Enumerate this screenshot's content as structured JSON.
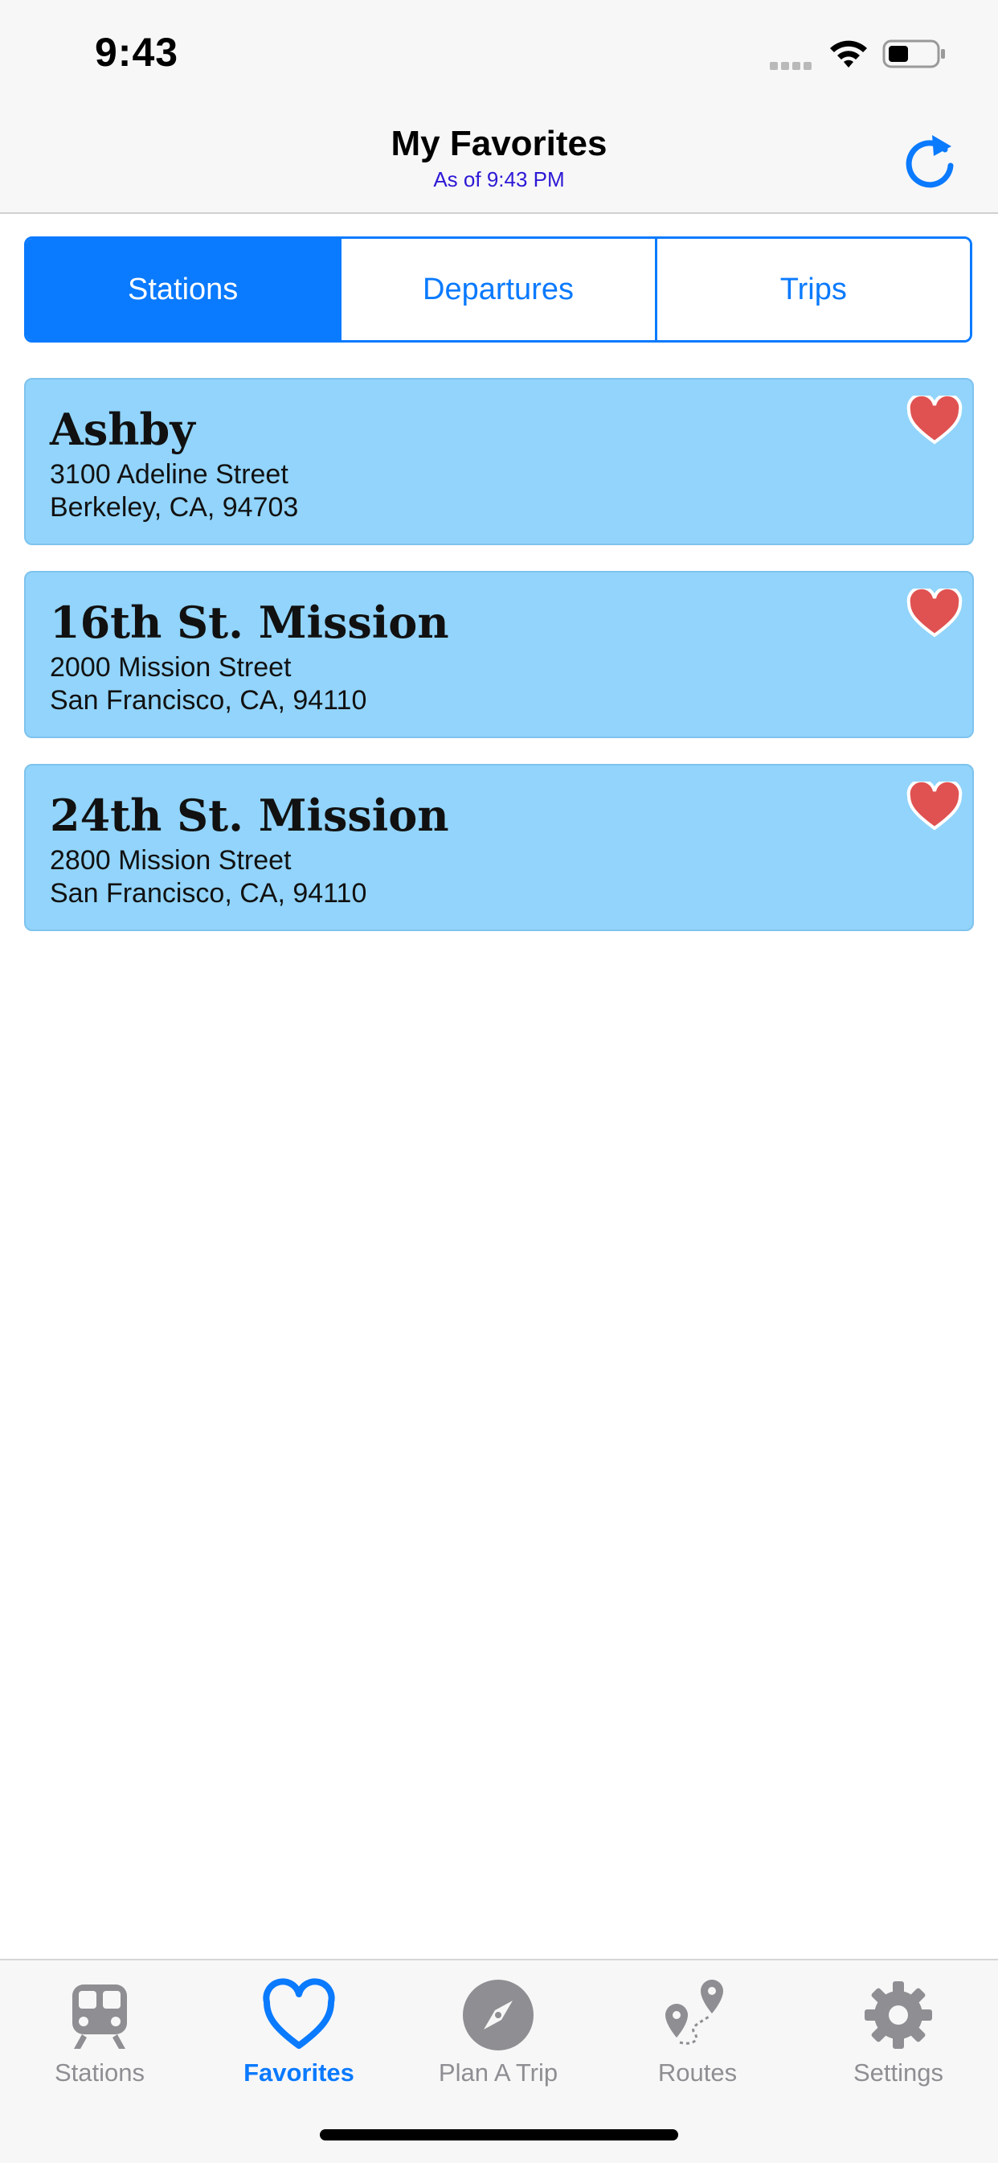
{
  "status_bar": {
    "time": "9:43"
  },
  "nav": {
    "title": "My Favorites",
    "subtitle": "As of 9:43 PM"
  },
  "segments": [
    {
      "label": "Stations",
      "selected": true
    },
    {
      "label": "Departures",
      "selected": false
    },
    {
      "label": "Trips",
      "selected": false
    }
  ],
  "stations": [
    {
      "name": "Ashby",
      "street": "3100 Adeline Street",
      "city": "Berkeley, CA, 94703",
      "favorite_icon": "heart-icon"
    },
    {
      "name": "16th St. Mission",
      "street": "2000 Mission Street",
      "city": "San Francisco, CA, 94110",
      "favorite_icon": "heart-icon"
    },
    {
      "name": "24th St. Mission",
      "street": "2800 Mission Street",
      "city": "San Francisco, CA, 94110",
      "favorite_icon": "heart-icon"
    }
  ],
  "tabs": [
    {
      "label": "Stations",
      "icon": "train-icon",
      "selected": false
    },
    {
      "label": "Favorites",
      "icon": "heart-icon",
      "selected": true
    },
    {
      "label": "Plan A Trip",
      "icon": "compass-icon",
      "selected": false
    },
    {
      "label": "Routes",
      "icon": "map-pins-icon",
      "selected": false
    },
    {
      "label": "Settings",
      "icon": "gear-icon",
      "selected": false
    }
  ],
  "colors": {
    "accent": "#0a7aff",
    "card_background": "#92d4fb",
    "heart": "#e05252",
    "subtitle": "#2d19d6",
    "inactive_tab": "#8e8e93"
  }
}
